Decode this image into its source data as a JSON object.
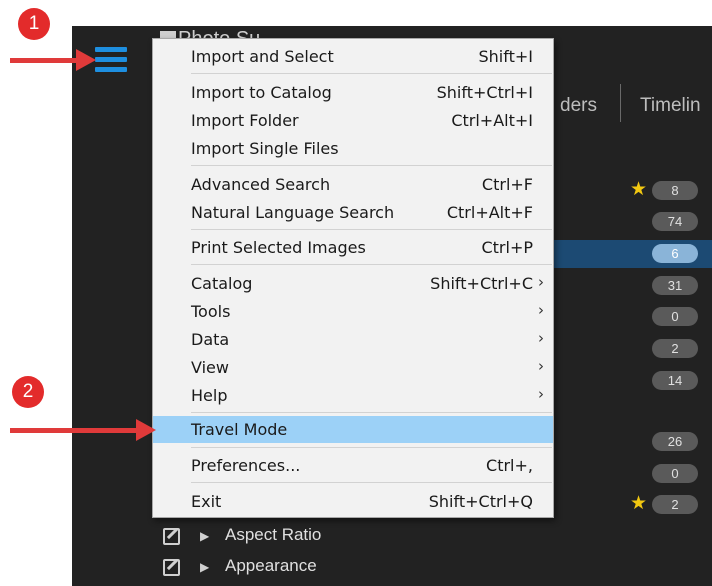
{
  "app": {
    "title": "Photo Su...",
    "tabs": [
      "ders",
      "Timelin"
    ]
  },
  "counts": [
    {
      "value": "8",
      "star": true
    },
    {
      "value": "74",
      "star": false
    },
    {
      "value": "6",
      "star": false,
      "selected": true
    },
    {
      "value": "31",
      "star": false
    },
    {
      "value": "0",
      "star": false
    },
    {
      "value": "2",
      "star": false
    },
    {
      "value": "14",
      "star": false
    },
    {
      "value": "26",
      "star": false
    },
    {
      "value": "0",
      "star": false
    },
    {
      "value": "2",
      "star": true
    }
  ],
  "filters": [
    {
      "label": "Aspect Ratio"
    },
    {
      "label": "Appearance"
    }
  ],
  "menu": {
    "items": [
      {
        "label": "Import and Select",
        "shortcut": "Shift+I"
      },
      {
        "label": "Import to Catalog",
        "shortcut": "Shift+Ctrl+I"
      },
      {
        "label": "Import Folder",
        "shortcut": "Ctrl+Alt+I"
      },
      {
        "label": "Import Single Files",
        "shortcut": ""
      },
      {
        "label": "Advanced Search",
        "shortcut": "Ctrl+F"
      },
      {
        "label": "Natural Language Search",
        "shortcut": "Ctrl+Alt+F"
      },
      {
        "label": "Print Selected Images",
        "shortcut": "Ctrl+P"
      },
      {
        "label": "Catalog",
        "shortcut": "Shift+Ctrl+C",
        "submenu": true
      },
      {
        "label": "Tools",
        "shortcut": "",
        "submenu": true
      },
      {
        "label": "Data",
        "shortcut": "",
        "submenu": true
      },
      {
        "label": "View",
        "shortcut": "",
        "submenu": true
      },
      {
        "label": "Help",
        "shortcut": "",
        "submenu": true
      },
      {
        "label": "Travel Mode",
        "shortcut": "",
        "highlighted": true
      },
      {
        "label": "Preferences...",
        "shortcut": "Ctrl+,"
      },
      {
        "label": "Exit",
        "shortcut": "Shift+Ctrl+Q"
      }
    ]
  },
  "annotations": {
    "badge1": "1",
    "badge2": "2"
  },
  "colors": {
    "menu_highlight": "#9cd1f7",
    "annotation_red": "#e32b2b",
    "hamburger_blue": "#1e8fe0"
  }
}
